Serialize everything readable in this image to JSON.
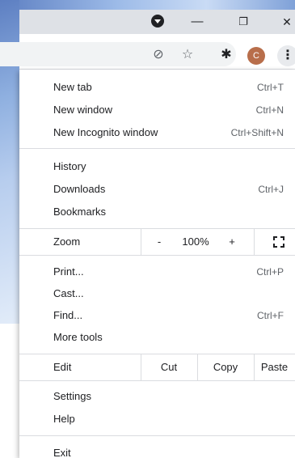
{
  "window": {
    "dropdown_icon": "dropdown-circle-icon",
    "minimize_glyph": "—",
    "restore_glyph": "❐",
    "close_glyph": "✕"
  },
  "toolbar": {
    "eye_off_glyph": "⊘",
    "star_glyph": "☆",
    "puzzle_glyph": "✱",
    "avatar_letter": "C",
    "menu_glyph": "⋮"
  },
  "menu": {
    "group1": [
      {
        "label": "New tab",
        "shortcut": "Ctrl+T"
      },
      {
        "label": "New window",
        "shortcut": "Ctrl+N"
      },
      {
        "label": "New Incognito window",
        "shortcut": "Ctrl+Shift+N"
      }
    ],
    "group2": [
      {
        "label": "History",
        "shortcut": ""
      },
      {
        "label": "Downloads",
        "shortcut": "Ctrl+J"
      },
      {
        "label": "Bookmarks",
        "shortcut": ""
      }
    ],
    "zoom": {
      "label": "Zoom",
      "minus": "-",
      "value": "100%",
      "plus": "+"
    },
    "group3": [
      {
        "label": "Print...",
        "shortcut": "Ctrl+P"
      },
      {
        "label": "Cast...",
        "shortcut": ""
      },
      {
        "label": "Find...",
        "shortcut": "Ctrl+F"
      },
      {
        "label": "More tools",
        "shortcut": ""
      }
    ],
    "edit": {
      "label": "Edit",
      "cut": "Cut",
      "copy": "Copy",
      "paste": "Paste"
    },
    "group4": [
      {
        "label": "Settings"
      },
      {
        "label": "Help"
      }
    ],
    "exit": {
      "label": "Exit"
    }
  }
}
